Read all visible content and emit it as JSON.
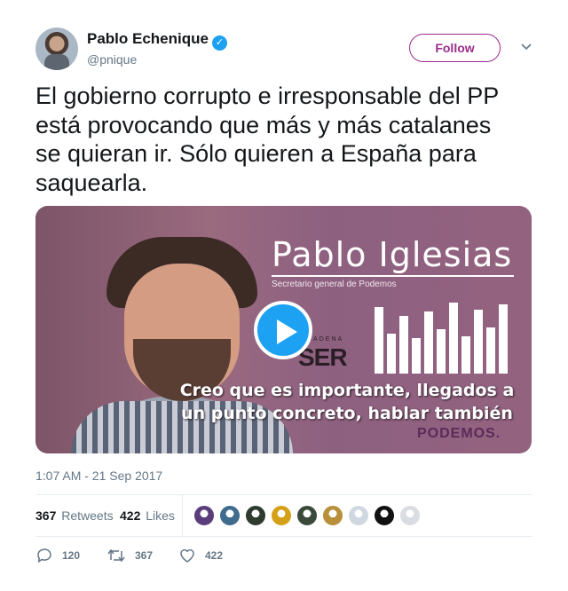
{
  "author": {
    "name": "Pablo Echenique",
    "handle": "@pnique",
    "verified": true
  },
  "header": {
    "follow_label": "Follow"
  },
  "tweet": {
    "text": "El gobierno corrupto e irresponsable del PP\nestá provocando que más y más catalanes\nse quieran ir. Sólo quieren a España para\nsaquearla."
  },
  "media": {
    "brand_name": "Pablo Iglesias",
    "brand_subtitle": "Secretario general de Podemos",
    "station_small": "CADENA",
    "station_logo": "SER",
    "caption_line1": "Creo que es importante, llegados a",
    "caption_line2": "un punto concreto, hablar también",
    "party": "PODEMOS."
  },
  "timestamp": "1:07 AM - 21 Sep 2017",
  "stats": {
    "retweets_count": "367",
    "retweets_label": "Retweets",
    "likes_count": "422",
    "likes_label": "Likes",
    "liker_colors": [
      "#5a3d7a",
      "#3f6b8f",
      "#2e3b2e",
      "#d4a017",
      "#3a4a3a",
      "#b8903a",
      "#cfd8e0",
      "#111111",
      "#d9dde3"
    ]
  },
  "actions": {
    "replies": "120",
    "retweets": "367",
    "likes": "422"
  },
  "colors": {
    "accent": "#1da1f2",
    "follow": "#9b2c8b",
    "muted": "#657786"
  }
}
